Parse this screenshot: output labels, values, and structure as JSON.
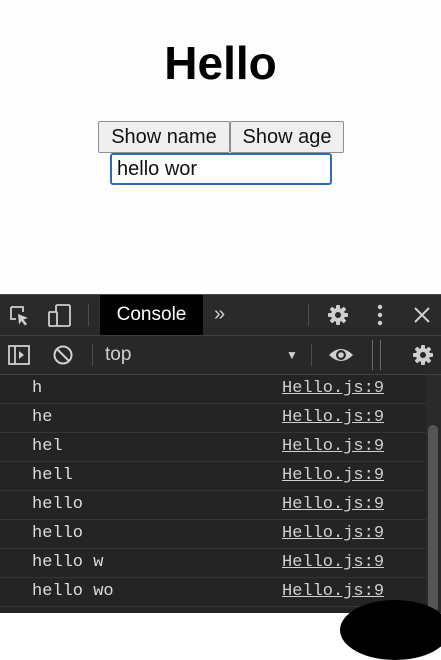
{
  "page": {
    "heading": "Hello",
    "buttons": {
      "show_name": "Show name",
      "show_age": "Show age"
    },
    "input_value": "hello wor"
  },
  "devtools": {
    "tabs": {
      "active": "Console"
    },
    "icons": [
      "inspect-element-icon",
      "device-toolbar-icon",
      "more-tabs-icon",
      "settings-gear-icon",
      "kebab-menu-icon",
      "close-icon",
      "sidebar-toggle-icon",
      "clear-console-icon",
      "live-expression-eye-icon",
      "console-settings-gear-icon"
    ],
    "context": "top",
    "logs": [
      {
        "message": "h",
        "source": "Hello.js:9"
      },
      {
        "message": "he",
        "source": "Hello.js:9"
      },
      {
        "message": "hel",
        "source": "Hello.js:9"
      },
      {
        "message": "hell",
        "source": "Hello.js:9"
      },
      {
        "message": "hello",
        "source": "Hello.js:9"
      },
      {
        "message": "hello",
        "source": "Hello.js:9"
      },
      {
        "message": "hello w",
        "source": "Hello.js:9"
      },
      {
        "message": "hello wo",
        "source": "Hello.js:9"
      }
    ]
  }
}
